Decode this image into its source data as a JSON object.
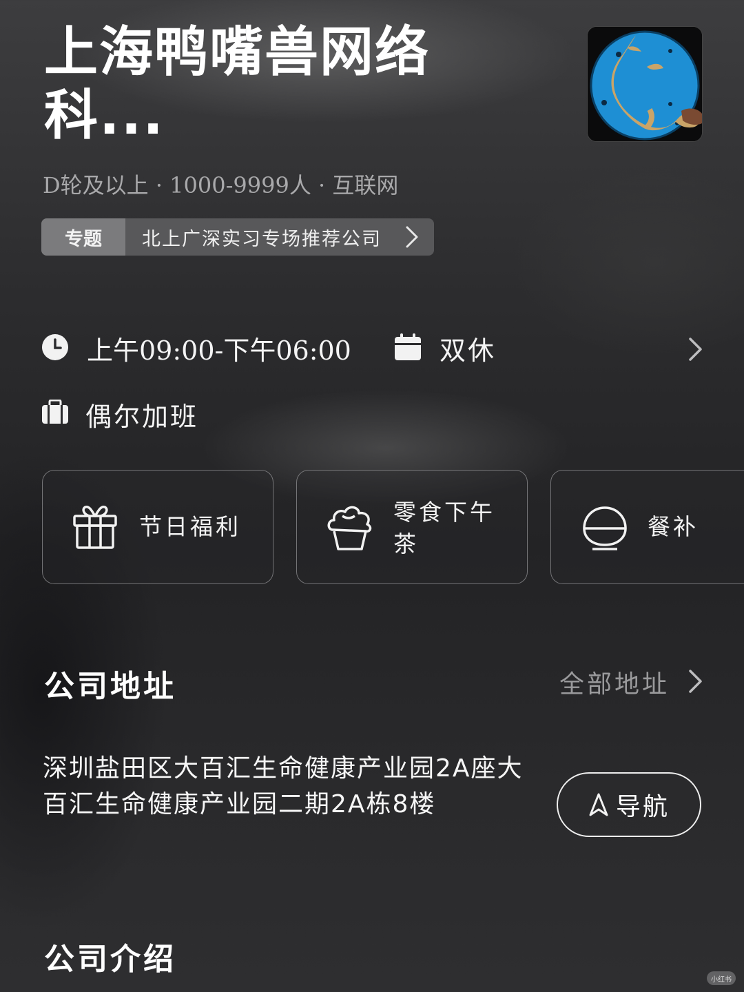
{
  "company": {
    "name": "上海鸭嘴兽网络科...",
    "meta": "D轮及以上 · 1000-9999人 · 互联网",
    "logo_icon": "platypus-logo"
  },
  "topic": {
    "tag": "专题",
    "text": "北上广深实习专场推荐公司"
  },
  "schedule": {
    "hours": "上午09:00-下午06:00",
    "rest": "双休",
    "overtime": "偶尔加班"
  },
  "benefits": [
    {
      "label": "节日福利",
      "icon": "gift-icon"
    },
    {
      "label": "零食下午茶",
      "icon": "cupcake-icon"
    },
    {
      "label": "餐补",
      "icon": "rice-bowl-icon"
    }
  ],
  "address_section": {
    "title": "公司地址",
    "all_link": "全部地址",
    "address": "深圳盐田区大百汇生命健康产业园2A座大百汇生命健康产业园二期2A栋8楼",
    "nav_label": "导航"
  },
  "intro_section": {
    "title": "公司介绍"
  },
  "watermark": "小红书"
}
